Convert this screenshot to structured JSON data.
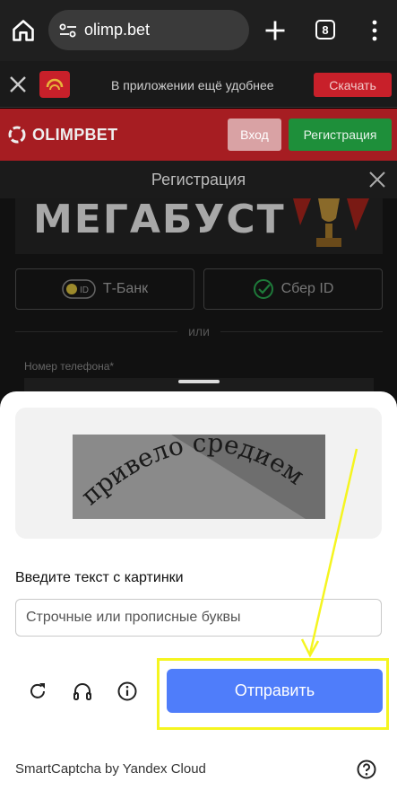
{
  "browser": {
    "url": "olimp.bet",
    "tab_count": "8"
  },
  "app_banner": {
    "text": "В приложении ещё удобнее",
    "button_label": "Скачать"
  },
  "site_header": {
    "logo_text": "OLIMPBET",
    "login_label": "Вход",
    "register_label": "Регистрация"
  },
  "registration": {
    "title": "Регистрация",
    "promo_text": "МЕГАБУСТ",
    "tbank_label": "Т-Банк",
    "tbank_badge": "ID",
    "sber_label": "Сбер ID",
    "or_text": "или",
    "phone_label": "Номер телефона*"
  },
  "captcha": {
    "image_text": "привело средием",
    "prompt": "Введите текст с картинки",
    "input_placeholder": "Строчные или прописные буквы",
    "input_value": "",
    "submit_label": "Отправить",
    "brand": "SmartCaptcha by Yandex Cloud"
  },
  "colors": {
    "brand_red": "#a61d22",
    "register_green": "#1e8f3a",
    "submit_blue": "#4f7dfa",
    "annotation_yellow": "#f5f520"
  }
}
